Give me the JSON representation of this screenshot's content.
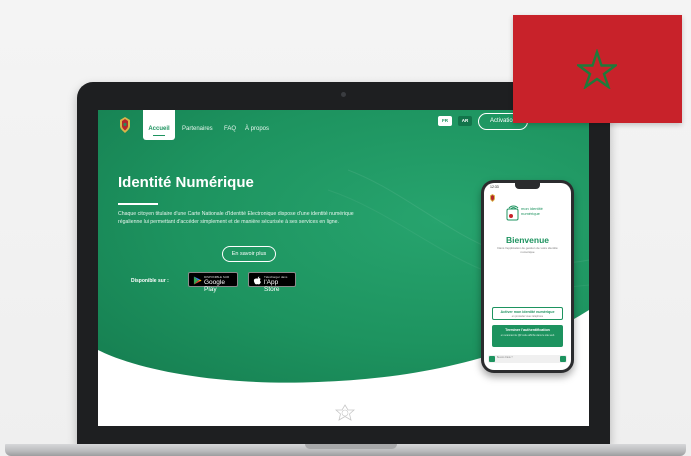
{
  "nav": {
    "active": "Accueil",
    "links": [
      "Partenaires",
      "FAQ",
      "À propos"
    ],
    "lang_fr": "FR",
    "lang_ar": "AR",
    "activate": "Activation"
  },
  "hero": {
    "title": "Identité Numérique",
    "description": "Chaque citoyen titulaire d'une Carte Nationale d'Identité Electronique dispose d'une identité numérique régalienne lui permettant d'accéder simplement et de manière sécurisée à ses services en ligne.",
    "learn_more": "En savoir plus",
    "available_on": "Disponible sur :"
  },
  "stores": {
    "google_small": "DISPONIBLE SUR",
    "google_big": "Google Play",
    "apple_small": "Télécharger dans",
    "apple_big": "l'App Store"
  },
  "phone": {
    "time": "12:33",
    "logo_text": "mon identité numérique",
    "welcome": "Bienvenue",
    "subtitle": "Dans l'application de gestion de votre identité numérique",
    "activate_title": "Activer mon identité numérique",
    "activate_sub": "en procédez avec téléphone",
    "finish_title": "Terminer l'authentification",
    "finish_sub": "en scannant le QR code affiché dans le site web",
    "bottom_hint": "Besoin d'aide ?"
  },
  "colors": {
    "green": "#1d935f",
    "flag_red": "#c8222a",
    "star_green": "#1f7a3a"
  },
  "icons": [
    "royal-crest-icon",
    "google-play-icon",
    "apple-icon",
    "star-icon",
    "id-logo-icon",
    "ornament-icon"
  ]
}
